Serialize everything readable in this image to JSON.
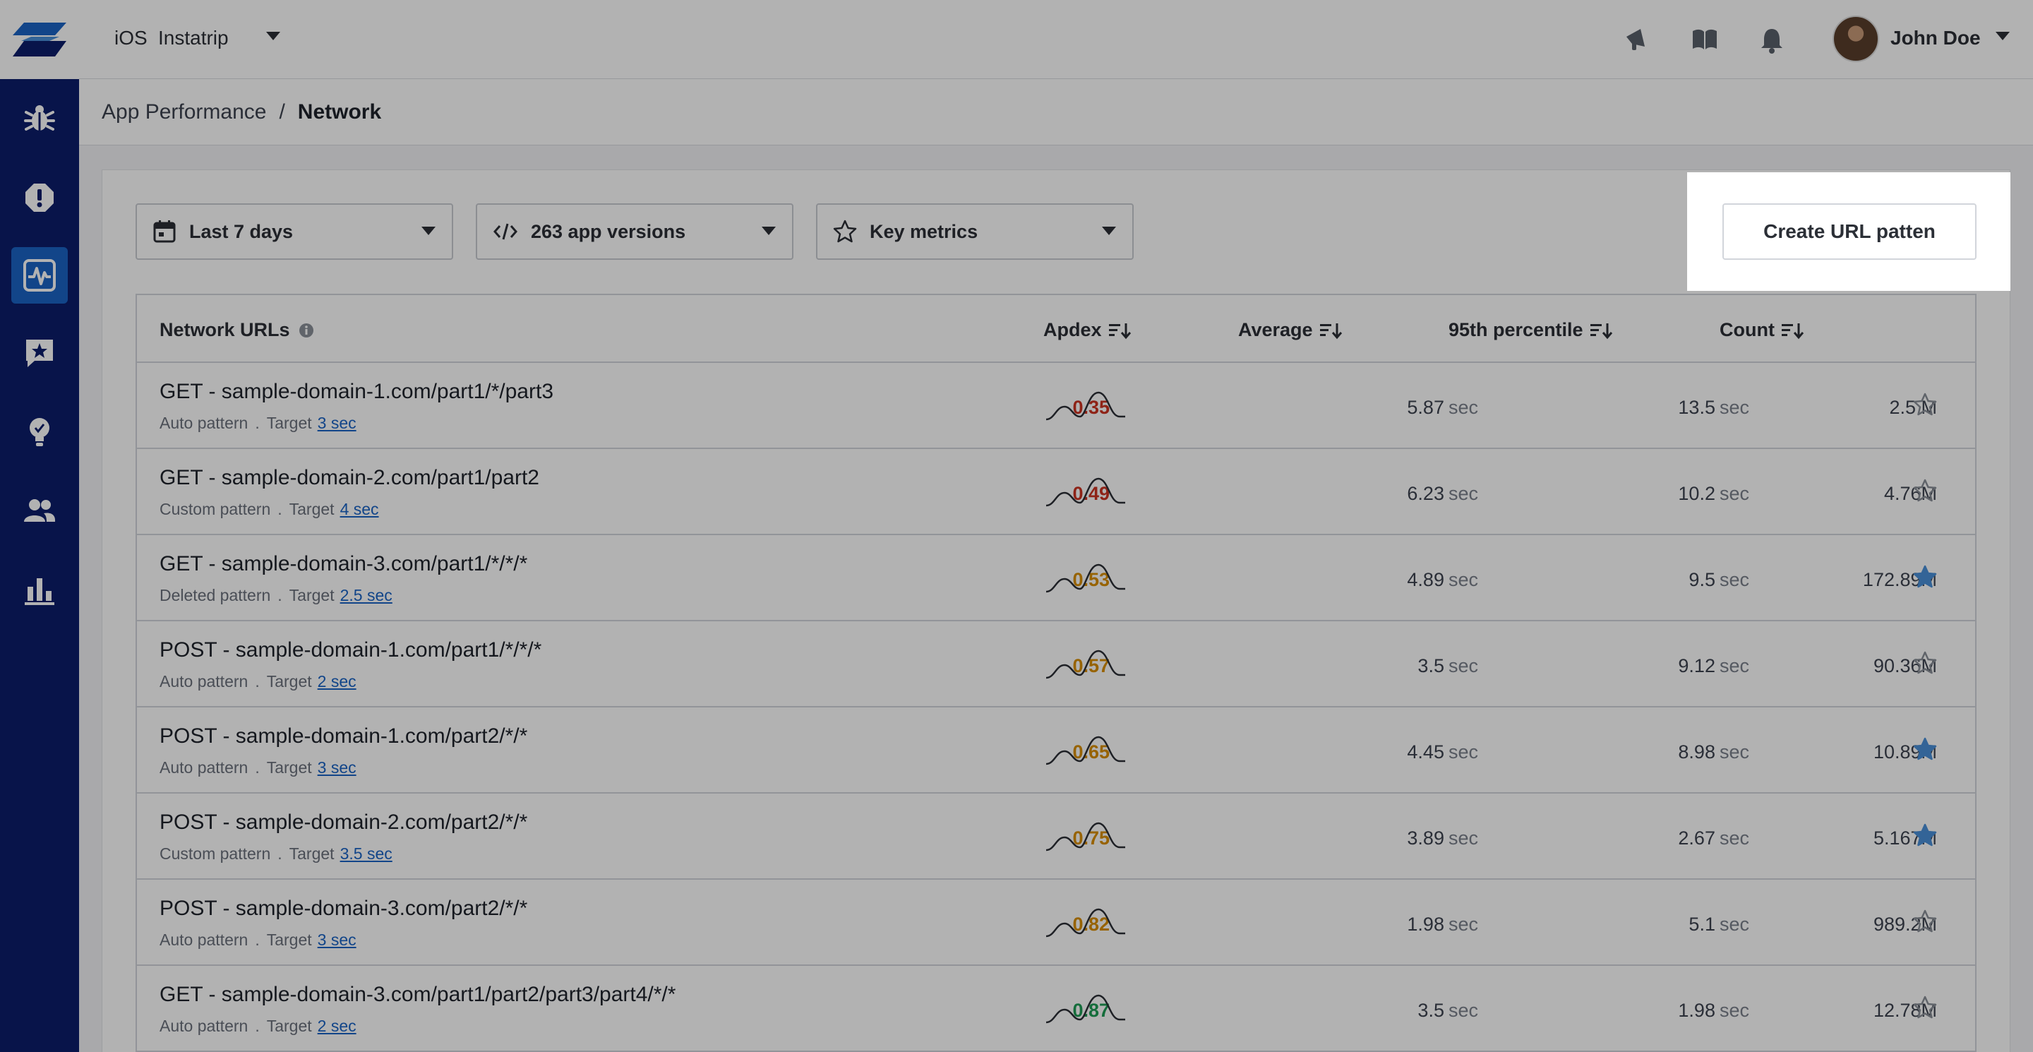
{
  "colors": {
    "sidebar_bg": "#0c1e6b",
    "active_nav": "#1b64c4",
    "apdex_red": "#cc3322",
    "apdex_orange": "#d98e04",
    "apdex_green": "#1f9d55",
    "star_filled": "#4a90d9",
    "link": "#1b64c4"
  },
  "sidebar": {
    "items": [
      {
        "icon": "bug-icon"
      },
      {
        "icon": "alert-icon"
      },
      {
        "icon": "performance-icon",
        "active": true
      },
      {
        "icon": "feedback-star-icon"
      },
      {
        "icon": "lightbulb-icon"
      },
      {
        "icon": "users-icon"
      },
      {
        "icon": "bar-chart-icon"
      }
    ]
  },
  "topbar": {
    "platform": "iOS",
    "app_name": "Instatrip",
    "icons": [
      "megaphone-icon",
      "book-icon",
      "bell-icon"
    ],
    "user_name": "John Doe"
  },
  "breadcrumb": {
    "parent": "App Performance",
    "separator": "/",
    "current": "Network"
  },
  "filters": {
    "date": "Last 7 days",
    "versions": "263 app versions",
    "metrics": "Key metrics"
  },
  "create_button": "Create URL patten",
  "table": {
    "headers": {
      "url": "Network URLs",
      "apdex": "Apdex",
      "average": "Average",
      "p95": "95th percentile",
      "count": "Count"
    },
    "target_label": "Target",
    "meta_separator": ".",
    "rows": [
      {
        "url": "GET - sample-domain-1.com/part1/*/part3",
        "pattern": "Auto pattern",
        "target": "3 sec",
        "apdex": "0.35",
        "apdex_level": "red",
        "average": "5.87",
        "average_unit": "sec",
        "p95": "13.5",
        "p95_unit": "sec",
        "count": "2.5 M",
        "starred": false
      },
      {
        "url": "GET - sample-domain-2.com/part1/part2",
        "pattern": "Custom pattern",
        "target": "4 sec",
        "apdex": "0.49",
        "apdex_level": "red",
        "average": "6.23",
        "average_unit": "sec",
        "p95": "10.2",
        "p95_unit": "sec",
        "count": "4.76M",
        "starred": false
      },
      {
        "url": "GET - sample-domain-3.com/part1/*/*/*",
        "pattern": "Deleted pattern",
        "target": "2.5 sec",
        "apdex": "0.53",
        "apdex_level": "orange",
        "average": "4.89",
        "average_unit": "sec",
        "p95": "9.5",
        "p95_unit": "sec",
        "count": "172.89M",
        "starred": true
      },
      {
        "url": "POST - sample-domain-1.com/part1/*/*/*",
        "pattern": "Auto pattern",
        "target": "2 sec",
        "apdex": "0.57",
        "apdex_level": "orange",
        "average": "3.5",
        "average_unit": "sec",
        "p95": "9.12",
        "p95_unit": "sec",
        "count": "90.36M",
        "starred": false
      },
      {
        "url": "POST - sample-domain-1.com/part2/*/*",
        "pattern": "Auto pattern",
        "target": "3 sec",
        "apdex": "0.65",
        "apdex_level": "orange",
        "average": "4.45",
        "average_unit": "sec",
        "p95": "8.98",
        "p95_unit": "sec",
        "count": "10.89M",
        "starred": true
      },
      {
        "url": "POST - sample-domain-2.com/part2/*/*",
        "pattern": "Custom pattern",
        "target": "3.5 sec",
        "apdex": "0.75",
        "apdex_level": "orange",
        "average": "3.89",
        "average_unit": "sec",
        "p95": "2.67",
        "p95_unit": "sec",
        "count": "5.167M",
        "starred": true
      },
      {
        "url": "POST - sample-domain-3.com/part2/*/*",
        "pattern": "Auto pattern",
        "target": "3 sec",
        "apdex": "0.82",
        "apdex_level": "orange",
        "average": "1.98",
        "average_unit": "sec",
        "p95": "5.1",
        "p95_unit": "sec",
        "count": "989.2M",
        "starred": false
      },
      {
        "url": "GET - sample-domain-3.com/part1/part2/part3/part4/*/*",
        "pattern": "Auto pattern",
        "target": "2 sec",
        "apdex": "0.87",
        "apdex_level": "green",
        "average": "3.5",
        "average_unit": "sec",
        "p95": "1.98",
        "p95_unit": "sec",
        "count": "12.78M",
        "starred": false
      }
    ]
  }
}
